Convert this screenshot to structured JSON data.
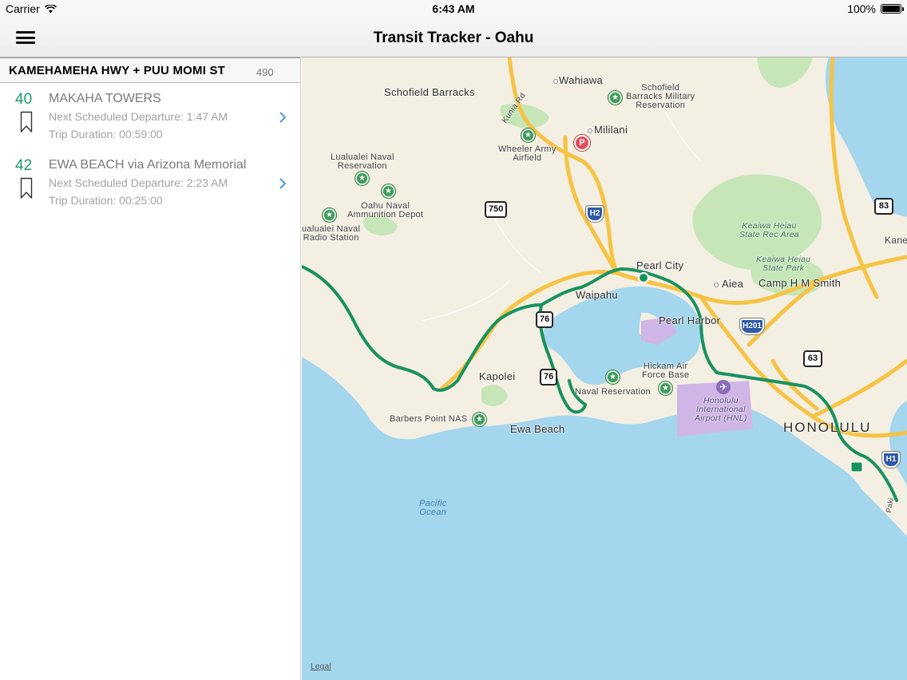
{
  "status_bar": {
    "carrier": "Carrier",
    "time": "6:43 AM",
    "battery": "100%",
    "battery_level": 1.0
  },
  "nav": {
    "title": "Transit Tracker - Oahu",
    "menu_icon": "hamburger-menu-icon"
  },
  "stop": {
    "name": "KAMEHAMEHA HWY + PUU MOMI ST",
    "id": "490"
  },
  "routes": [
    {
      "number": "40",
      "destination": "MAKAHA TOWERS",
      "next_departure": "Next Scheduled Departure: 1:47 AM",
      "trip_duration": "Trip Duration: 00:59:00"
    },
    {
      "number": "42",
      "destination": "EWA BEACH via Arizona Memorial",
      "next_departure": "Next Scheduled Departure: 2:23 AM",
      "trip_duration": "Trip Duration: 00:25:00"
    }
  ],
  "map": {
    "labels": {
      "schofield_barracks": "Schofield Barracks",
      "wahiawa": "Wahiawa",
      "schofield_military_1": "Schofield",
      "schofield_military_2": "Barracks Military",
      "schofield_military_3": "Reservation",
      "kunia_rd": "Kunia Rd",
      "mililani": "Mililani",
      "wheeler_1": "Wheeler Army",
      "wheeler_2": "Airfield",
      "lualualei_naval_1": "Lualualei Naval",
      "lualualei_naval_2": "Reservation",
      "oahu_naval_1": "Oahu Naval",
      "oahu_naval_2": "Ammunition Depot",
      "lualualei_radio_1": "ualualei Naval",
      "lualualei_radio_2": "Radio Station",
      "keaiwa_heiau_area_1": "Keaiwa Heiau",
      "keaiwa_heiau_area_2": "State Rec Area",
      "keaiwa_heiau_park_1": "Keaiwa Heiau",
      "keaiwa_heiau_park_2": "State Park",
      "kane": "Kane",
      "pearl_city": "Pearl City",
      "aiea": "Aiea",
      "camp_smith": "Camp H M Smith",
      "waipahu": "Waipahu",
      "pearl_harbor": "Pearl Harbor",
      "kapolei": "Kapolei",
      "hickam_1": "Hickam Air",
      "hickam_2": "Force Base",
      "naval_reservation": "Naval Reservation",
      "honolulu_airport_1": "Honolulu",
      "honolulu_airport_2": "International",
      "honolulu_airport_3": "Airport (HNL)",
      "barbers_point": "Barbers Point NAS",
      "ewa_beach": "Ewa Beach",
      "honolulu": "HONOLULU",
      "pacific_ocean_1": "Pacific",
      "pacific_ocean_2": "Ocean",
      "paki": "Paki",
      "legal": "Legal"
    },
    "shields": {
      "r750": "750",
      "r83": "83",
      "r63": "63",
      "r76": "76",
      "r7x": "76",
      "h2": "H2",
      "h201": "H201",
      "h1": "H1",
      "parking": "P"
    },
    "colors": {
      "water": "#a4d6ee",
      "land": "#f4efe3",
      "park": "#c6e6b8",
      "highway": "#f6c343",
      "route": "#17915f",
      "airport": "#d0b6e6"
    }
  }
}
